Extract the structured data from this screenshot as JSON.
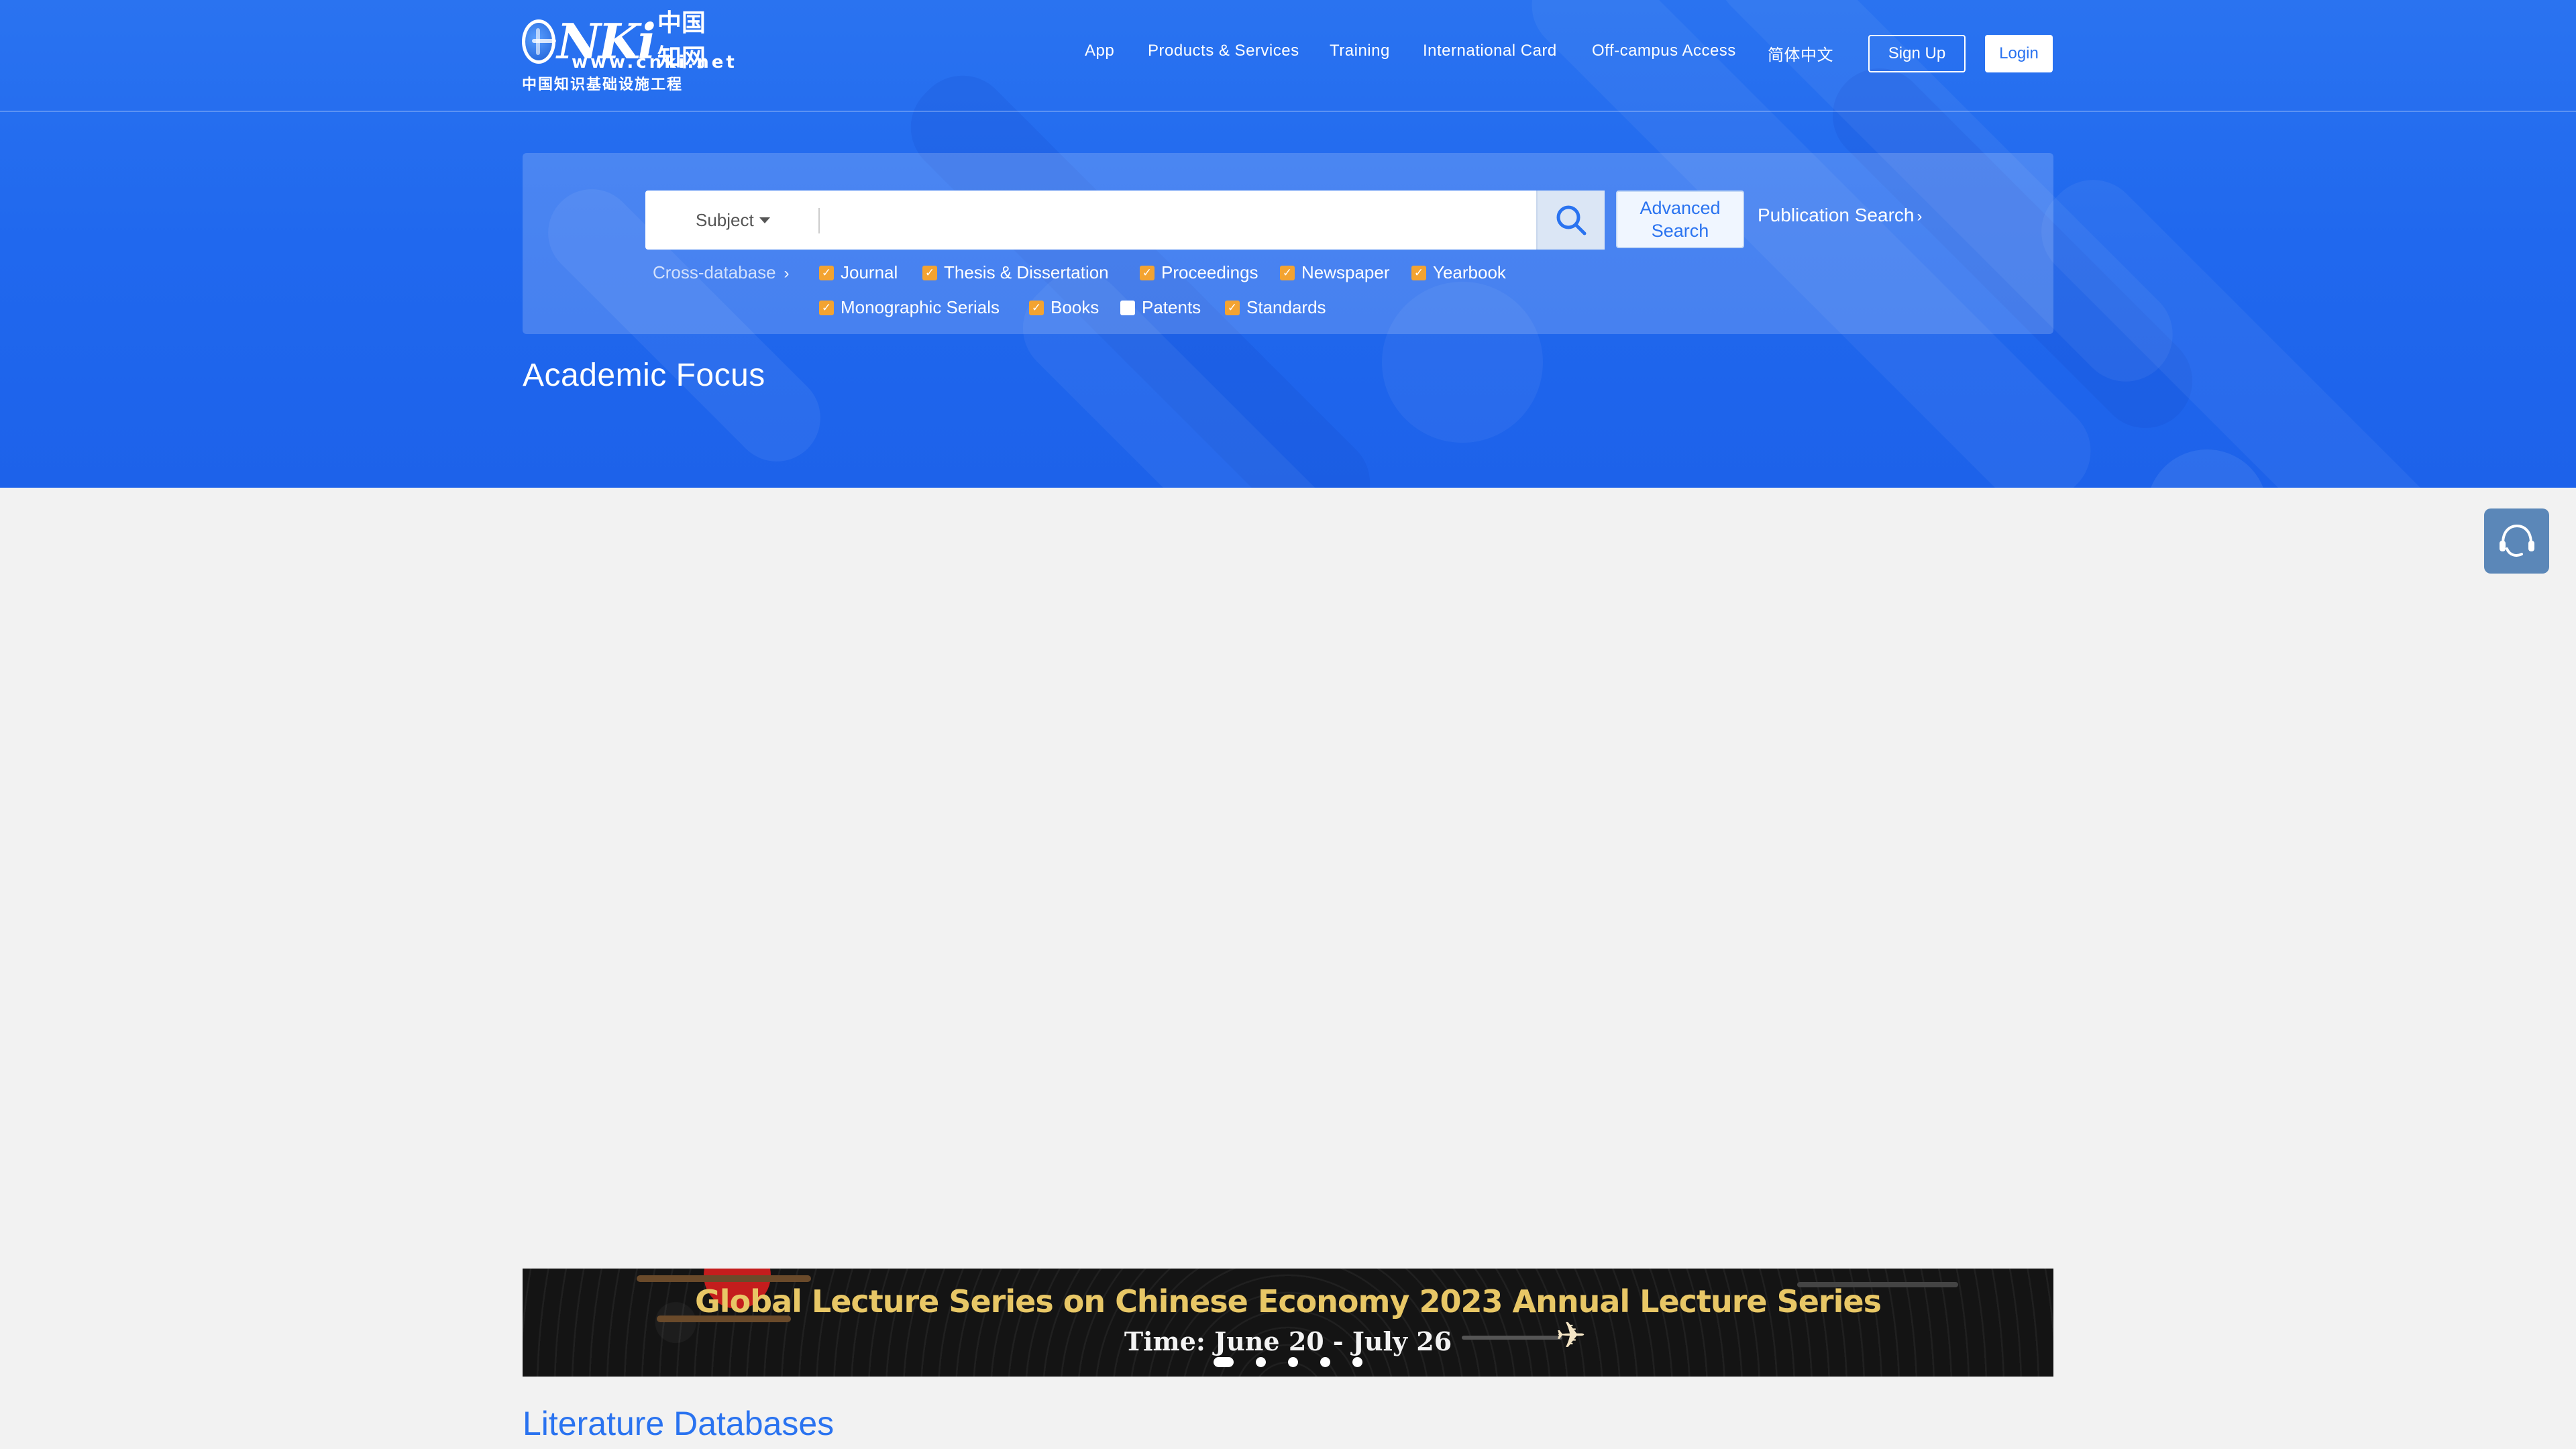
{
  "logo": {
    "brand": "NKi",
    "brand_cn": "中国知网",
    "url": "www.cnki.net",
    "tagline": "中国知识基础设施工程"
  },
  "nav": {
    "items": [
      "App",
      "Products & Services",
      "Training",
      "International Card",
      "Off-campus Access",
      "简体中文"
    ],
    "signup": "Sign Up",
    "login": "Login"
  },
  "search": {
    "field_select": "Subject",
    "input_value": "",
    "input_placeholder": "",
    "advanced_line1": "Advanced",
    "advanced_line2": "Search",
    "publication_search": "Publication Search",
    "cross_database": "Cross-database",
    "databases": [
      {
        "label": "Journal",
        "checked": true
      },
      {
        "label": "Thesis & Dissertation",
        "checked": true
      },
      {
        "label": "Proceedings",
        "checked": true
      },
      {
        "label": "Newspaper",
        "checked": true
      },
      {
        "label": "Yearbook",
        "checked": true
      },
      {
        "label": "Monographic Serials",
        "checked": true
      },
      {
        "label": "Books",
        "checked": true
      },
      {
        "label": "Patents",
        "checked": false
      },
      {
        "label": "Standards",
        "checked": true
      }
    ]
  },
  "sections": {
    "academic_focus": "Academic Focus",
    "literature_databases": "Literature Databases"
  },
  "banner": {
    "title": "Global Lecture Series on Chinese Economy 2023 Annual Lecture Series",
    "time": "Time: June 20 - July 26",
    "slides": 5,
    "active_slide": 1
  },
  "colors": {
    "primary": "#2a73f0",
    "checkbox": "#f3a331",
    "banner_title": "#e8c766",
    "page_bg": "#f2f2f2"
  },
  "icons": {
    "search": "search-icon",
    "service": "customer-service-icon"
  }
}
